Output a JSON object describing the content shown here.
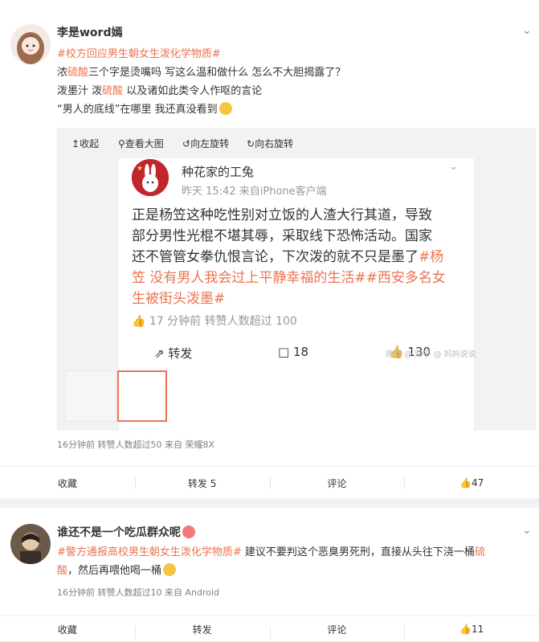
{
  "posts": [
    {
      "username": "李是word嫣",
      "hashtag": "#校方回应男生朝女生泼化学物质#",
      "lines": [
        {
          "a": "浓",
          "kw": "硫酸",
          "b": "三个字是烫嘴吗 写这么温和做什么 怎么不大胆揭露了？"
        },
        {
          "a": "泼墨汁 泼",
          "kw": "硫酸",
          "b": " 以及诸如此类令人作呕的言论"
        },
        {
          "a": "“男人的底线”在哪里 我还真没看到"
        }
      ],
      "toolbar": {
        "collapse": "收起",
        "view_large": "查看大图",
        "rotate_left": "向左旋转",
        "rotate_right": "向右旋转"
      },
      "embedded": {
        "username": "种花家的工兔",
        "time": "昨天 15:42",
        "source": "来自iPhone客户端",
        "text_plain": "正是杨笠这种吃性别对立饭的人渣大行其道，导致部分男性光棍不堪其辱，采取线下恐怖活动。国家还不管管女拳仇恨言论，下次泼的就不只是墨了",
        "text_lines": [
          "正是杨笠这种吃性别对立饭的人渣大行其道，导致",
          "部分男性光棍不堪其辱，采取线下恐怖活动。国家",
          "还不管管女拳仇恨言论，下次泼的就不只是墨了"
        ],
        "hashtag1_a": "#杨",
        "hashtag1_b": "笠 没有男人我会过上平静幸福的生活#",
        "hashtag2": "#西安多名女",
        "hashtag2_b": "生被街头泼墨#",
        "meta": "17 分钟前  转赞人数超过 100",
        "repost": "转发",
        "comments": "18",
        "likes": "130",
        "watermark": "微博 @ 知乎 @ 妈妈说说"
      },
      "meta": "16分钟前  转赞人数超过50  来自 荣耀8X",
      "actions": {
        "favorite": "收藏",
        "repost": "转发 5",
        "comment": "评论",
        "like": "47"
      }
    },
    {
      "username": "谁还不是一个吃瓜群众呢",
      "hashtag": "#警方通报高校男生朝女生泼化学物质#",
      "line1_rest": " 建议不要判这个恶臭男死刑，直接从头往下浇一桶",
      "kw": "硫",
      "line2_kw": "酸",
      "line2_rest": "，然后再喂他喝一桶",
      "meta": "16分钟前  转赞人数超过10  来自 Android",
      "actions": {
        "favorite": "收藏",
        "repost": "转发",
        "comment": "评论",
        "like": "11"
      }
    }
  ],
  "colors": {
    "accent": "#eb7350",
    "link": "#eb7350",
    "page_bg": "#f2f2f5"
  }
}
